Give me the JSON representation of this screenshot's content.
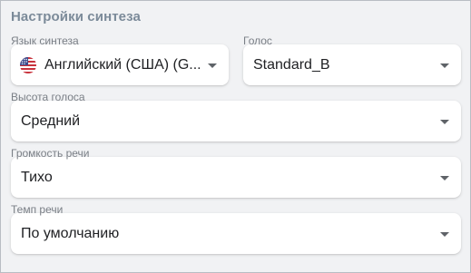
{
  "panel": {
    "title": "Настройки синтеза"
  },
  "fields": {
    "language": {
      "label": "Язык синтеза",
      "value": "Английский (США) (G...",
      "flag_icon": "us-flag-icon",
      "caret_icon": "dropdown-arrow-icon"
    },
    "voice": {
      "label": "Голос",
      "value": "Standard_B",
      "caret_icon": "dropdown-arrow-icon"
    },
    "pitch": {
      "label": "Высота голоса",
      "value": "Средний",
      "caret_icon": "dropdown-arrow-icon"
    },
    "volume": {
      "label": "Громкость речи",
      "value": "Тихо",
      "caret_icon": "dropdown-arrow-icon"
    },
    "rate": {
      "label": "Темп речи",
      "value": "По умолчанию",
      "caret_icon": "dropdown-arrow-icon"
    }
  },
  "colors": {
    "panel_bg": "#f1f2f4",
    "title": "#7b8a99",
    "label": "#7a7f86",
    "value": "#202124"
  }
}
